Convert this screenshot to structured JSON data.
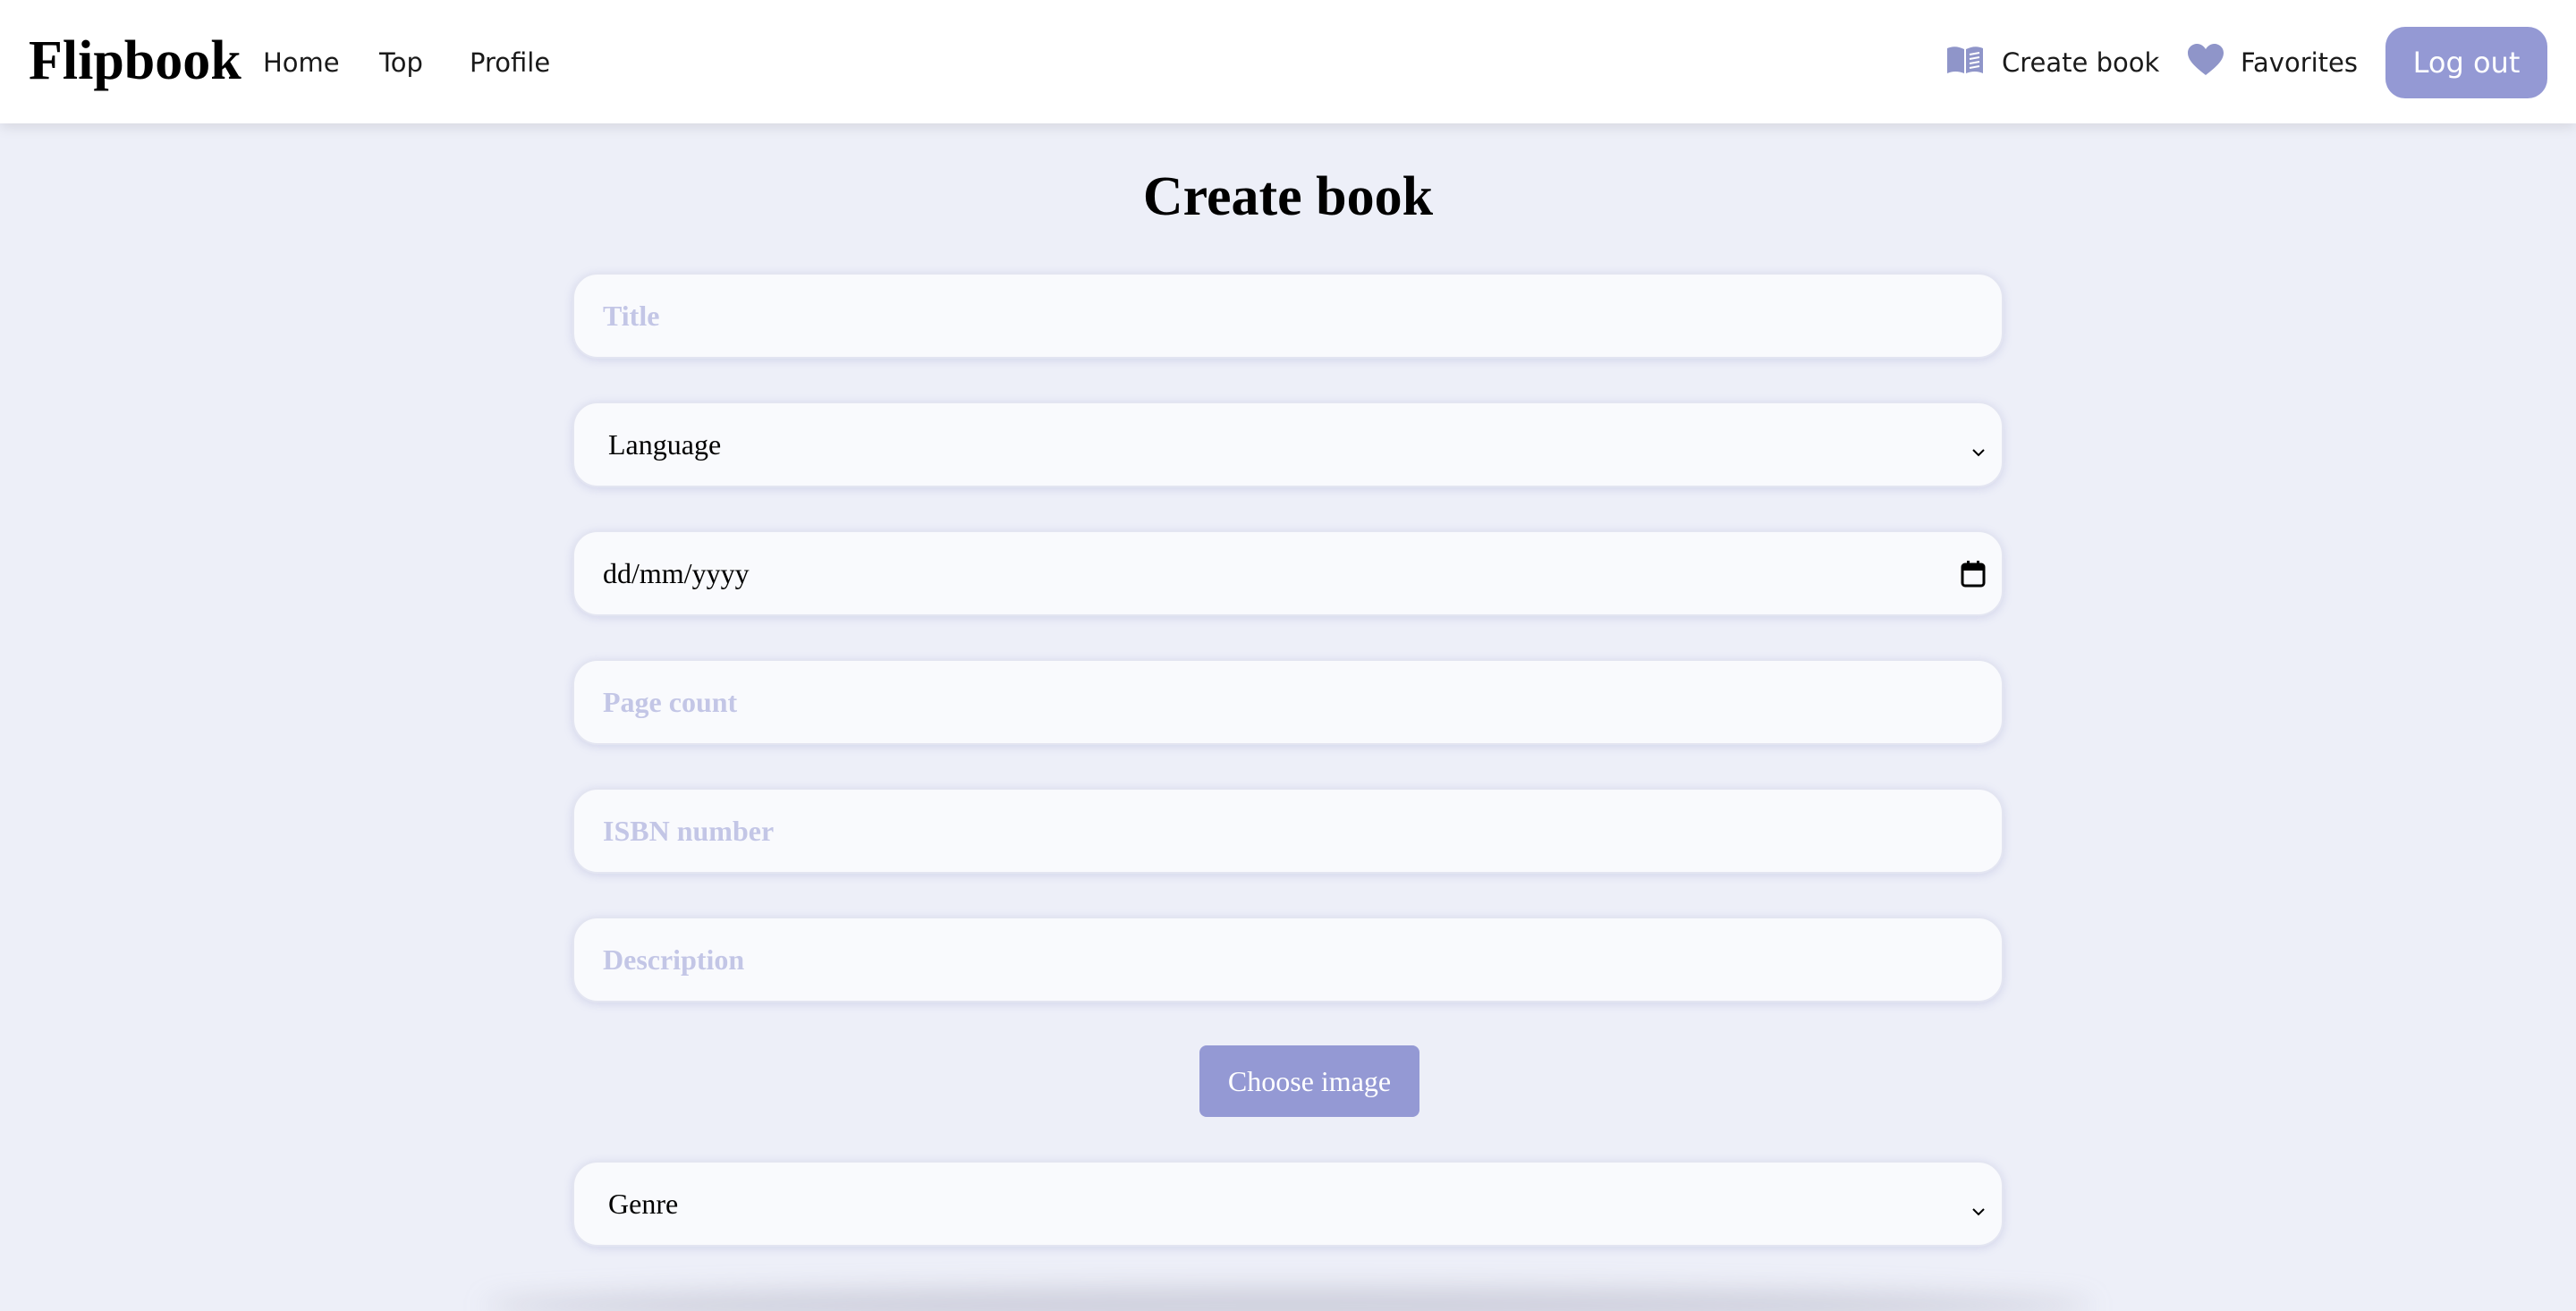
{
  "navbar": {
    "brand": "Flipbook",
    "links": {
      "home": "Home",
      "top": "Top",
      "profile": "Profile"
    },
    "create_book": "Create book",
    "favorites": "Favorites",
    "logout": "Log out",
    "icons": {
      "create_book": "open-book-icon",
      "favorites": "heart-icon"
    }
  },
  "form": {
    "heading": "Create book",
    "title_placeholder": "Title",
    "language_value": "Language",
    "date_placeholder": "dd/mm/yyyy",
    "page_count_placeholder": "Page count",
    "isbn_placeholder": "ISBN number",
    "description_placeholder": "Description",
    "choose_image_label": "Choose image",
    "genre_value": "Genre"
  },
  "colors": {
    "accent": "#9499d4",
    "page_background": "#edeff8",
    "field_background": "#f9fafd",
    "placeholder": "#c3c6e6"
  }
}
